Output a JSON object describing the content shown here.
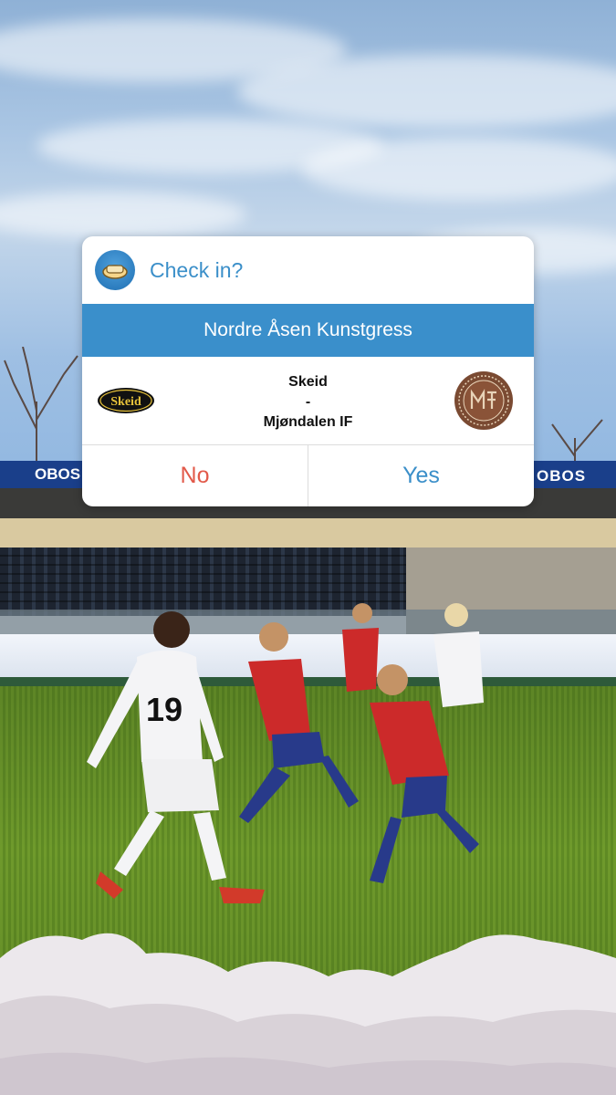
{
  "background": {
    "stadium_sponsor": "OBOS"
  },
  "dialog": {
    "title": "Check in?",
    "venue": "Nordre Åsen Kunstgress",
    "home_team": "Skeid",
    "separator": "-",
    "away_team": "Mjøndalen IF",
    "home_logo_text": "Skeid",
    "no_label": "No",
    "yes_label": "Yes",
    "colors": {
      "title": "#3b8fc9",
      "venue_bar": "#3a8fcb",
      "no": "#e25a4a",
      "yes": "#3b8fc9"
    },
    "icons": [
      "checkin-app-icon",
      "skeid-logo",
      "mjondalen-logo"
    ]
  }
}
